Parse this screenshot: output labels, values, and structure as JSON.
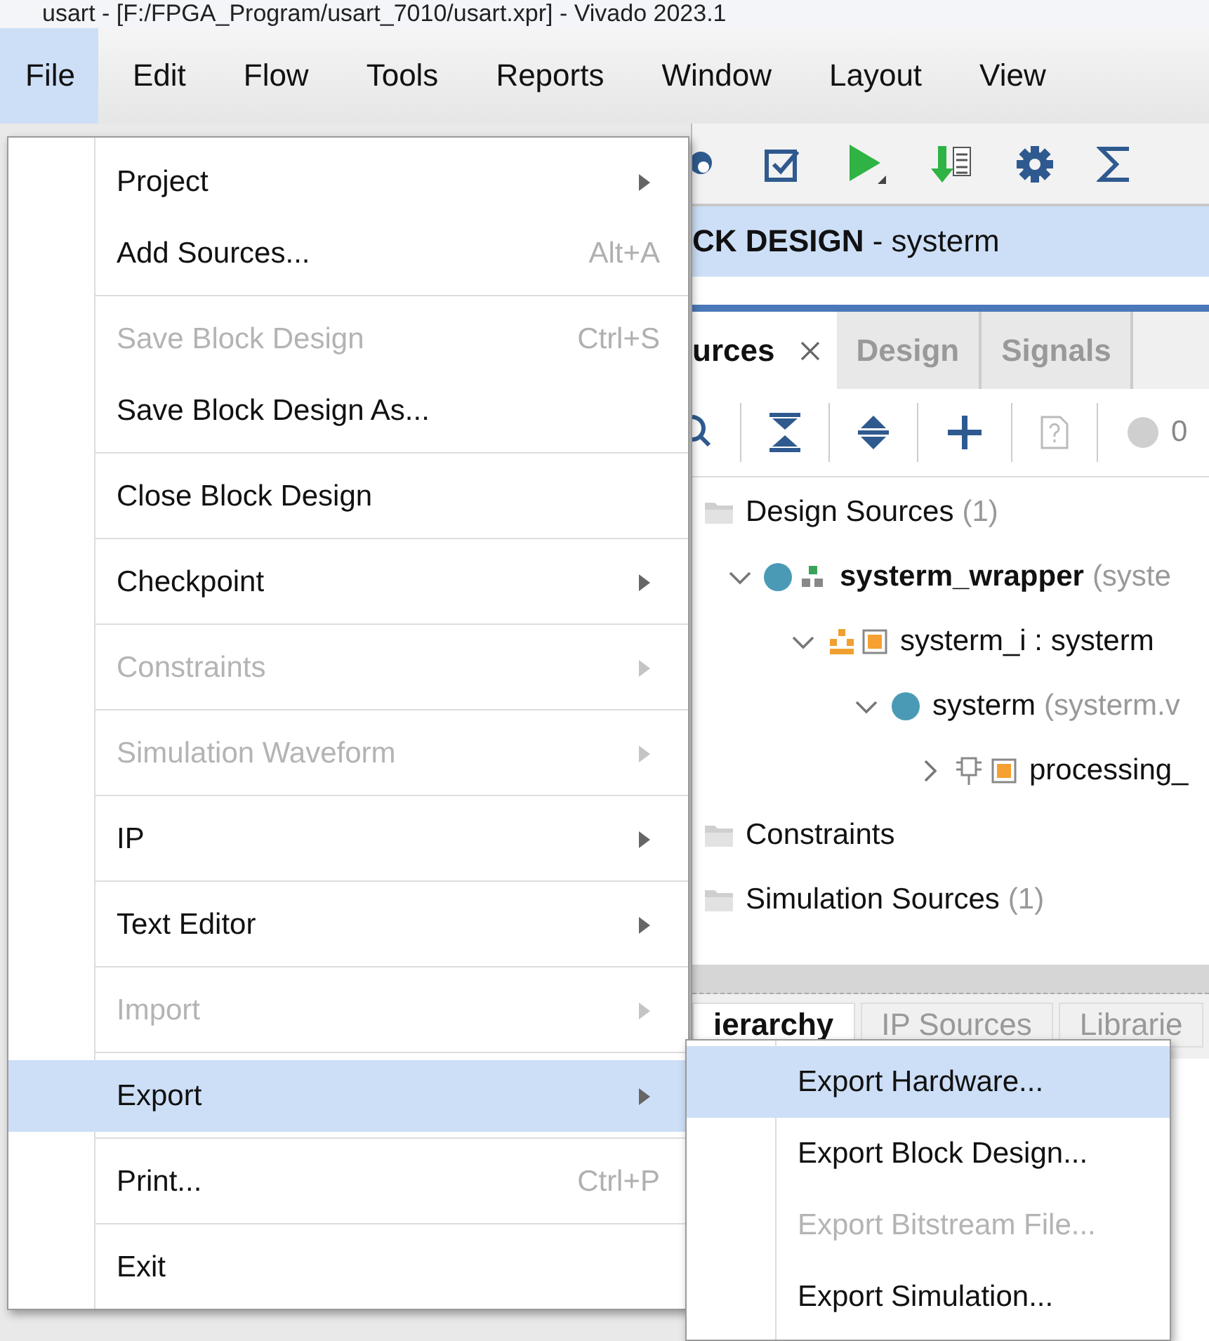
{
  "window": {
    "title": "usart - [F:/FPGA_Program/usart_7010/usart.xpr] - Vivado 2023.1"
  },
  "menubar": [
    {
      "label": "File",
      "selected": true
    },
    {
      "label": "Edit",
      "selected": false
    },
    {
      "label": "Flow",
      "selected": false
    },
    {
      "label": "Tools",
      "selected": false
    },
    {
      "label": "Reports",
      "selected": false
    },
    {
      "label": "Window",
      "selected": false
    },
    {
      "label": "Layout",
      "selected": false
    },
    {
      "label": "View",
      "selected": false
    }
  ],
  "editor_header": {
    "title": "**CK DESIGN** - systerm"
  },
  "sources_tabs": [
    {
      "label": "urces",
      "selected": true,
      "closable": true
    },
    {
      "label": "Design",
      "selected": false,
      "closable": false
    },
    {
      "label": "Signals",
      "selected": false,
      "closable": false
    }
  ],
  "sources_toolbar": {
    "count": "0"
  },
  "tree": [
    {
      "kind": "folder",
      "name": "Design Sources",
      "note": "(1)",
      "top": false,
      "children": [
        {
          "kind": "wrapper",
          "name": "systerm_wrapper",
          "note": "(syste",
          "top": true,
          "expanded": true,
          "children": [
            {
              "kind": "instance",
              "name": "systerm_i : systerm",
              "top": false,
              "expanded": true,
              "children": [
                {
                  "kind": "design",
                  "name": "systerm",
                  "note": "(systerm.v",
                  "top": false,
                  "expanded": true,
                  "children": [
                    {
                      "kind": "ip",
                      "name": "processing_",
                      "top": false,
                      "expanded": false
                    }
                  ]
                }
              ]
            }
          ]
        }
      ]
    },
    {
      "kind": "folder",
      "name": "Constraints",
      "top": false
    },
    {
      "kind": "folder",
      "name": "Simulation Sources",
      "note": "(1)",
      "top": false
    }
  ],
  "bottom_tabs": [
    {
      "label": "ierarchy",
      "selected": true
    },
    {
      "label": "IP Sources",
      "selected": false
    },
    {
      "label": "Librarie",
      "selected": false
    }
  ],
  "file_menu": {
    "groups": [
      [
        {
          "label": "Project",
          "submenu": true,
          "disabled": false,
          "selected": false
        },
        {
          "label": "Add Sources...",
          "shortcut": "Alt+A",
          "submenu": false,
          "disabled": false,
          "selected": false
        }
      ],
      [
        {
          "label": "Save Block Design",
          "shortcut": "Ctrl+S",
          "submenu": false,
          "disabled": true,
          "selected": false
        },
        {
          "label": "Save Block Design As...",
          "submenu": false,
          "disabled": false,
          "selected": false
        }
      ],
      [
        {
          "label": "Close Block Design",
          "submenu": false,
          "disabled": false,
          "selected": false
        }
      ],
      [
        {
          "label": "Checkpoint",
          "submenu": true,
          "disabled": false,
          "selected": false
        }
      ],
      [
        {
          "label": "Constraints",
          "submenu": true,
          "disabled": true,
          "selected": false
        }
      ],
      [
        {
          "label": "Simulation Waveform",
          "submenu": true,
          "disabled": true,
          "selected": false
        }
      ],
      [
        {
          "label": "IP",
          "submenu": true,
          "disabled": false,
          "selected": false
        }
      ],
      [
        {
          "label": "Text Editor",
          "submenu": true,
          "disabled": false,
          "selected": false
        }
      ],
      [
        {
          "label": "Import",
          "submenu": true,
          "disabled": true,
          "selected": false
        }
      ],
      [
        {
          "label": "Export",
          "submenu": true,
          "disabled": false,
          "selected": true
        }
      ],
      [
        {
          "label": "Print...",
          "shortcut": "Ctrl+P",
          "submenu": false,
          "disabled": false,
          "selected": false
        }
      ],
      [
        {
          "label": "Exit",
          "submenu": false,
          "disabled": false,
          "selected": false
        }
      ]
    ]
  },
  "export_submenu": [
    {
      "label": "Export Hardware...",
      "disabled": false,
      "selected": true
    },
    {
      "label": "Export Block Design...",
      "disabled": false,
      "selected": false
    },
    {
      "label": "Export Bitstream File...",
      "disabled": true,
      "selected": false
    },
    {
      "label": "Export Simulation...",
      "disabled": false,
      "selected": false
    }
  ]
}
